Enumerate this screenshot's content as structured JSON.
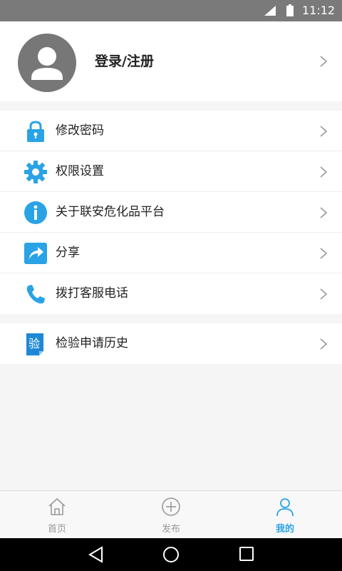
{
  "status_bar": {
    "time": "11:12"
  },
  "profile": {
    "login_label": "登录/注册"
  },
  "menu": {
    "items": [
      {
        "label": "修改密码",
        "icon": "lock-icon"
      },
      {
        "label": "权限设置",
        "icon": "gear-icon"
      },
      {
        "label": "关于联安危化品平台",
        "icon": "info-icon"
      },
      {
        "label": "分享",
        "icon": "share-icon"
      },
      {
        "label": "拨打客服电话",
        "icon": "phone-icon"
      }
    ],
    "extra": [
      {
        "label": "检验申请历史",
        "icon": "verify-icon",
        "icon_text": "验"
      }
    ]
  },
  "tabbar": {
    "tabs": [
      {
        "label": "首页",
        "icon": "home-icon",
        "active": false
      },
      {
        "label": "发布",
        "icon": "plus-circle-icon",
        "active": false
      },
      {
        "label": "我的",
        "icon": "user-icon",
        "active": true
      }
    ]
  },
  "colors": {
    "accent": "#2aa3e6",
    "status_bar": "#7a7a7a",
    "avatar_bg": "#777777"
  }
}
